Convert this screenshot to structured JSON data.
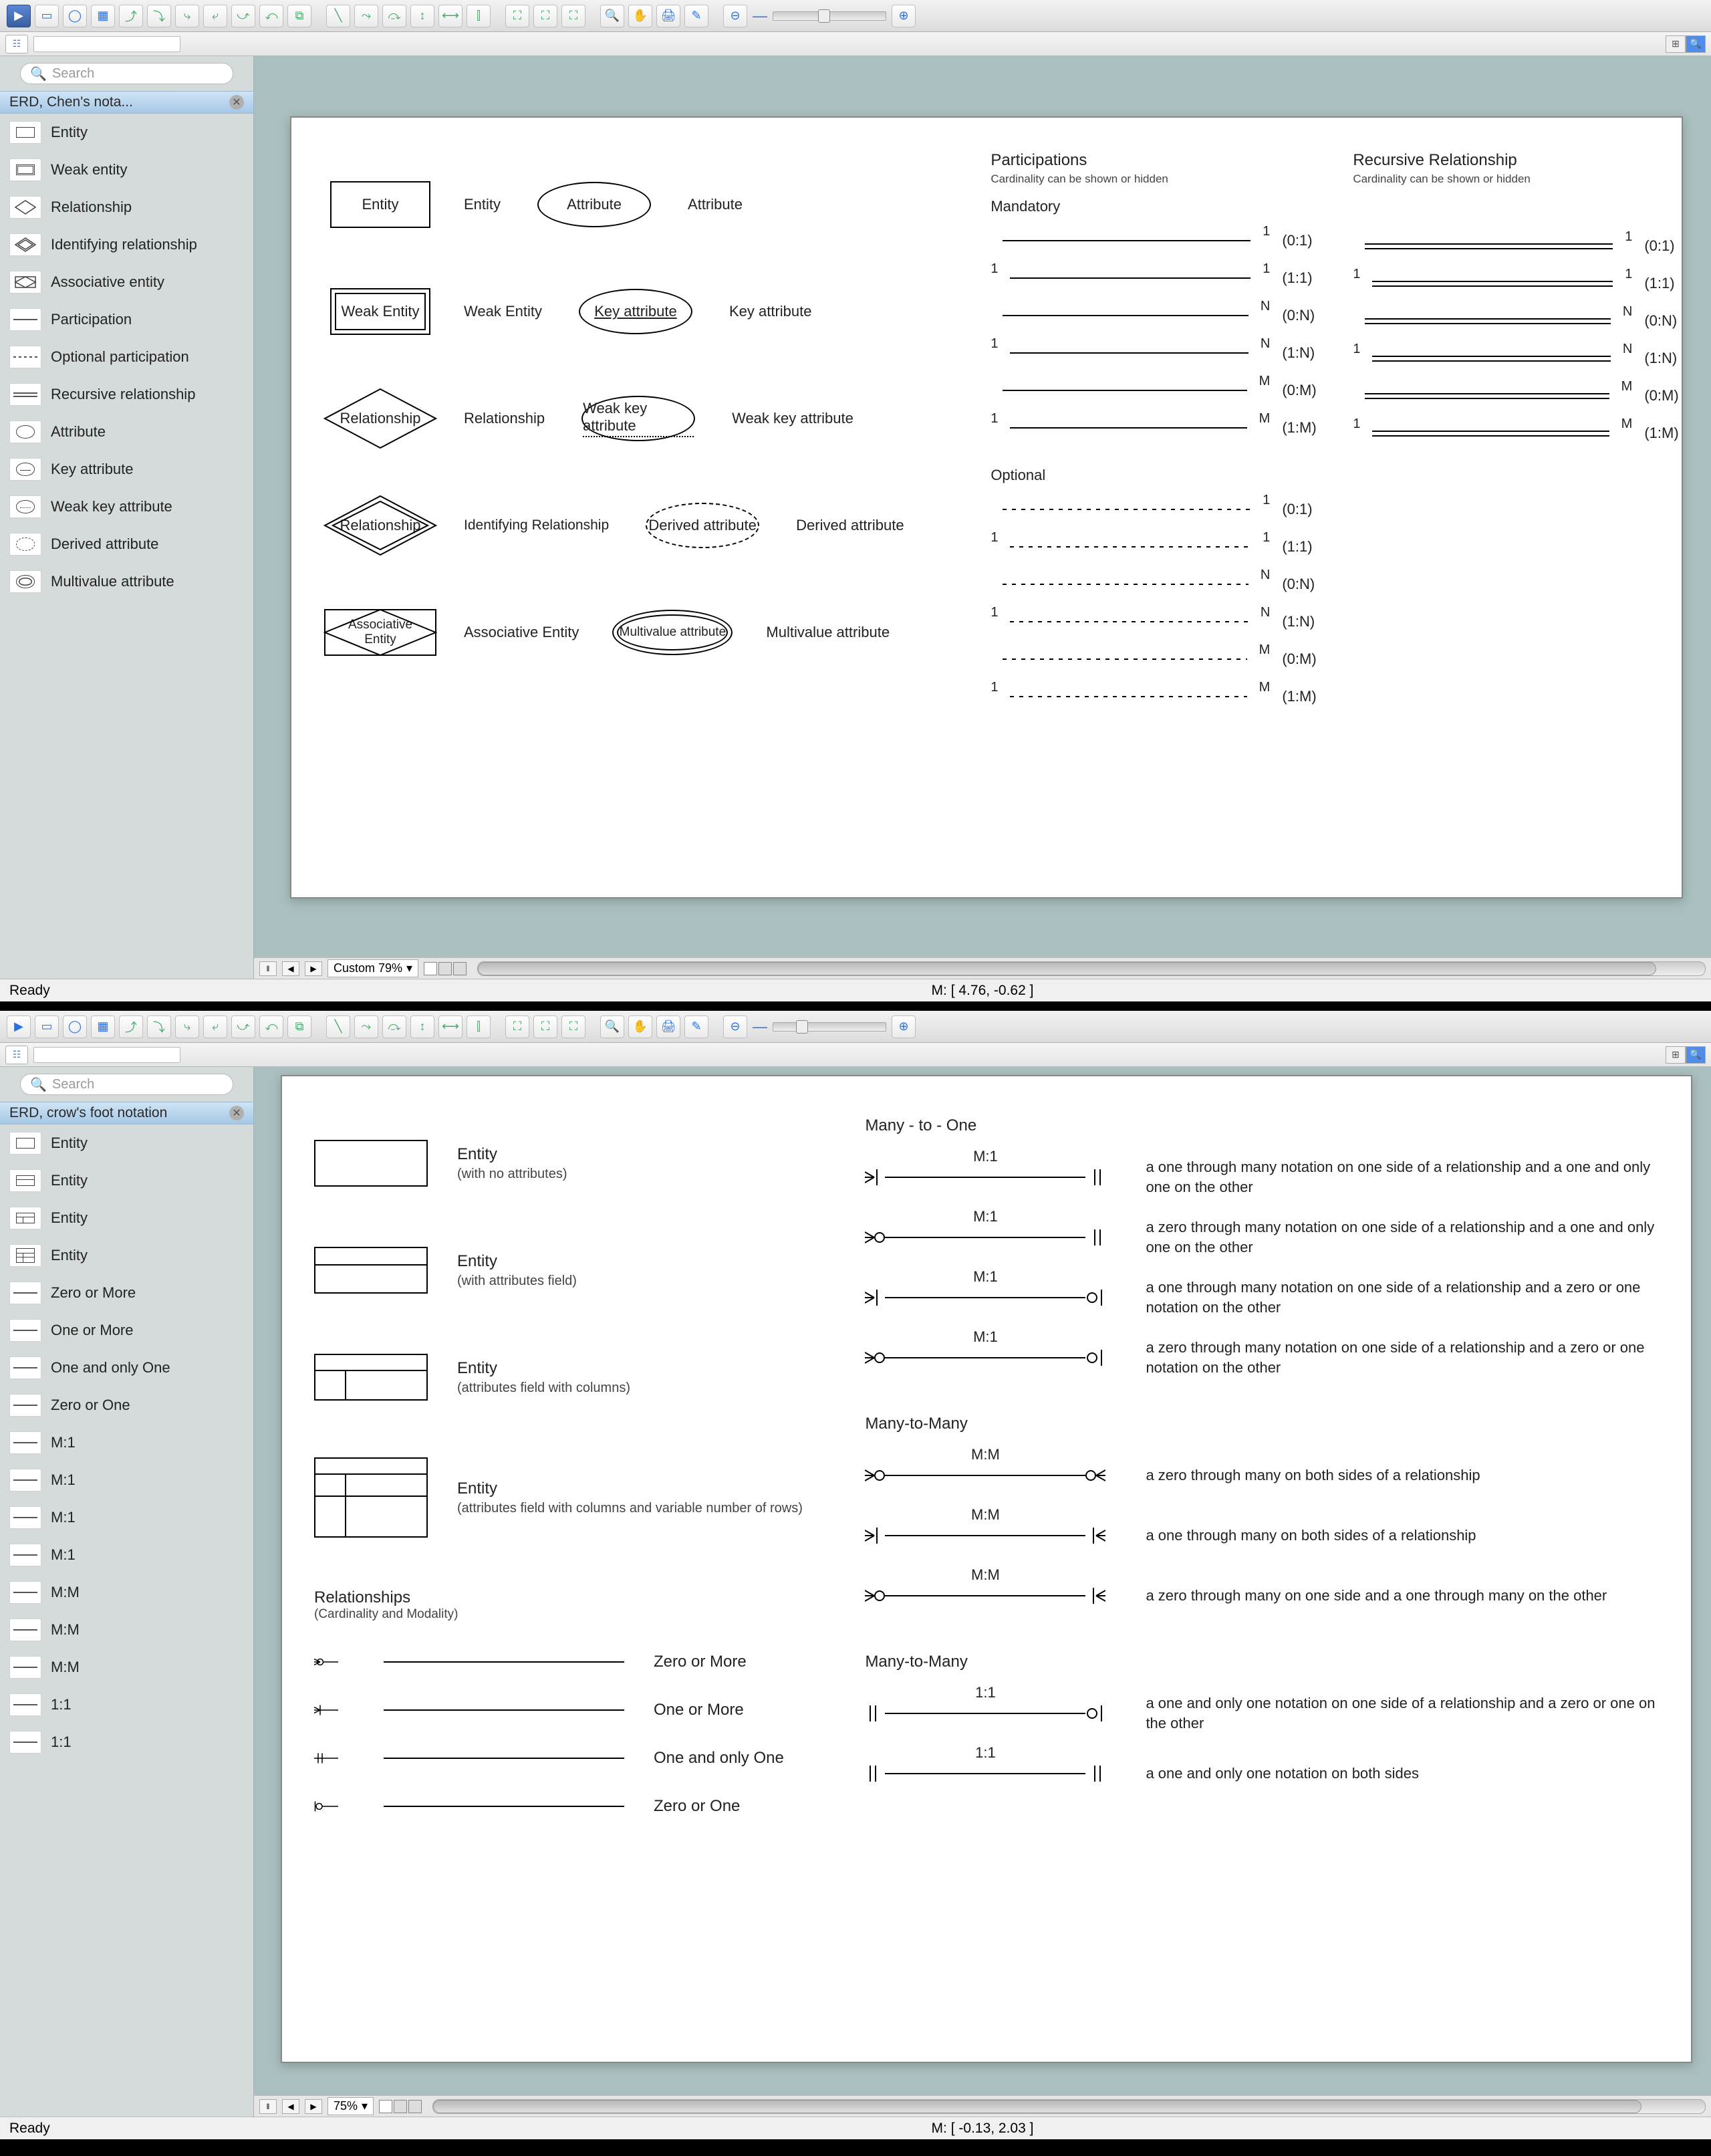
{
  "windows": {
    "top": {
      "search_placeholder": "Search",
      "sidebar_title": "ERD, Chen's nota...",
      "status_ready": "Ready",
      "status_center": "M: [ 4.76, -0.62 ]",
      "zoom_label": "Custom 79%",
      "stencils": [
        {
          "label": "Entity",
          "icon": "rect"
        },
        {
          "label": "Weak entity",
          "icon": "dblrect"
        },
        {
          "label": "Relationship",
          "icon": "diamond"
        },
        {
          "label": "Identifying relationship",
          "icon": "dbldiamond"
        },
        {
          "label": "Associative entity",
          "icon": "assoc"
        },
        {
          "label": "Participation",
          "icon": "line"
        },
        {
          "label": "Optional participation",
          "icon": "dashline"
        },
        {
          "label": "Recursive relationship",
          "icon": "dbline"
        },
        {
          "label": "Attribute",
          "icon": "ellipse"
        },
        {
          "label": "Key attribute",
          "icon": "ellipse-u"
        },
        {
          "label": "Weak key attribute",
          "icon": "ellipse-du"
        },
        {
          "label": "Derived attribute",
          "icon": "ellipse-dash"
        },
        {
          "label": "Multivalue attribute",
          "icon": "ellipse-dbl"
        }
      ],
      "chen": {
        "shapes": [
          {
            "box": "Entity",
            "label": "Entity",
            "attr_shape": "Attribute",
            "attr_label": "Attribute"
          },
          {
            "box": "Weak Entity",
            "label": "Weak Entity",
            "attr_shape": "Key attribute",
            "attr_label": "Key attribute"
          },
          {
            "box": "Relationship",
            "label": "Relationship",
            "attr_shape": "Weak key attribute",
            "attr_label": "Weak key attribute"
          },
          {
            "box": "Relationship",
            "label": "Identifying Relationship",
            "attr_shape": "Derived attribute",
            "attr_label": "Derived attribute"
          },
          {
            "box": "Associative\nEntity",
            "label": "Associative Entity",
            "attr_shape": "Multivalue attribute",
            "attr_label": "Multivalue attribute"
          }
        ],
        "part_header": "Participations",
        "part_sub": "Cardinality can be shown or hidden",
        "rec_header": "Recursive Relationship",
        "rec_sub": "Cardinality can be shown or hidden",
        "mandatory_label": "Mandatory",
        "optional_label": "Optional",
        "mandatory_rows": [
          {
            "l": "",
            "r": "1",
            "ratio": "(0:1)"
          },
          {
            "l": "1",
            "r": "1",
            "ratio": "(1:1)"
          },
          {
            "l": "",
            "r": "N",
            "ratio": "(0:N)"
          },
          {
            "l": "1",
            "r": "N",
            "ratio": "(1:N)"
          },
          {
            "l": "",
            "r": "M",
            "ratio": "(0:M)"
          },
          {
            "l": "1",
            "r": "M",
            "ratio": "(1:M)"
          }
        ],
        "optional_rows": [
          {
            "l": "",
            "r": "1",
            "ratio": "(0:1)"
          },
          {
            "l": "1",
            "r": "1",
            "ratio": "(1:1)"
          },
          {
            "l": "",
            "r": "N",
            "ratio": "(0:N)"
          },
          {
            "l": "1",
            "r": "N",
            "ratio": "(1:N)"
          },
          {
            "l": "",
            "r": "M",
            "ratio": "(0:M)"
          },
          {
            "l": "1",
            "r": "M",
            "ratio": "(1:M)"
          }
        ],
        "rec_rows": [
          {
            "l": "",
            "r": "1",
            "ratio": "(0:1)"
          },
          {
            "l": "1",
            "r": "1",
            "ratio": "(1:1)"
          },
          {
            "l": "",
            "r": "N",
            "ratio": "(0:N)"
          },
          {
            "l": "1",
            "r": "N",
            "ratio": "(1:N)"
          },
          {
            "l": "",
            "r": "M",
            "ratio": "(0:M)"
          },
          {
            "l": "1",
            "r": "M",
            "ratio": "(1:M)"
          }
        ]
      }
    },
    "bottom": {
      "search_placeholder": "Search",
      "sidebar_title": "ERD, crow's foot notation",
      "status_ready": "Ready",
      "status_center": "M: [ -0.13, 2.03 ]",
      "zoom_label": "75%",
      "stencils": [
        {
          "label": "Entity",
          "icon": "rect"
        },
        {
          "label": "Entity",
          "icon": "rectline"
        },
        {
          "label": "Entity",
          "icon": "rectcols"
        },
        {
          "label": "Entity",
          "icon": "rectrows"
        },
        {
          "label": "Zero or More",
          "icon": "rel-zm"
        },
        {
          "label": "One or More",
          "icon": "rel-om"
        },
        {
          "label": "One and only One",
          "icon": "rel-oo"
        },
        {
          "label": "Zero or One",
          "icon": "rel-zo"
        },
        {
          "label": "M:1",
          "icon": "rel-m1"
        },
        {
          "label": "M:1",
          "icon": "rel-m1"
        },
        {
          "label": "M:1",
          "icon": "rel-m1"
        },
        {
          "label": "M:1",
          "icon": "rel-m1"
        },
        {
          "label": "M:M",
          "icon": "rel-mm"
        },
        {
          "label": "M:M",
          "icon": "rel-mm"
        },
        {
          "label": "M:M",
          "icon": "rel-mm"
        },
        {
          "label": "1:1",
          "icon": "rel-11"
        },
        {
          "label": "1:1",
          "icon": "rel-11"
        }
      ],
      "crow": {
        "entities": [
          {
            "title": "Entity",
            "sub": "(with no attributes)"
          },
          {
            "title": "Entity",
            "sub": "(with attributes field)"
          },
          {
            "title": "Entity",
            "sub": "(attributes field with columns)"
          },
          {
            "title": "Entity",
            "sub": "(attributes field with columns and variable number of rows)"
          }
        ],
        "rel_header": "Relationships",
        "rel_sub": "(Cardinality and Modality)",
        "rels": [
          {
            "label": "Zero or More"
          },
          {
            "label": "One or More"
          },
          {
            "label": "One and only One"
          },
          {
            "label": "Zero or One"
          }
        ],
        "sections": [
          {
            "title": "Many - to - One",
            "rows": [
              {
                "ratio": "M:1",
                "desc": "a one through many notation on one side of a relationship and a one and only one on the other"
              },
              {
                "ratio": "M:1",
                "desc": "a zero through many notation on one side of a relationship and a one and only one on the other"
              },
              {
                "ratio": "M:1",
                "desc": "a one through many notation on one side of a relationship and a zero or one notation on the other"
              },
              {
                "ratio": "M:1",
                "desc": "a zero through many notation on one side of a relationship and a zero or one notation on the other"
              }
            ]
          },
          {
            "title": "Many-to-Many",
            "rows": [
              {
                "ratio": "M:M",
                "desc": "a zero through many on both sides of a relationship"
              },
              {
                "ratio": "M:M",
                "desc": "a one through many on both sides of a relationship"
              },
              {
                "ratio": "M:M",
                "desc": "a zero through many on one side and a one through many on the other"
              }
            ]
          },
          {
            "title": "Many-to-Many",
            "rows": [
              {
                "ratio": "1:1",
                "desc": "a one and only one notation on one side of a relationship and a zero or one on the other"
              },
              {
                "ratio": "1:1",
                "desc": "a one and only one notation on both sides"
              }
            ]
          }
        ]
      }
    }
  }
}
